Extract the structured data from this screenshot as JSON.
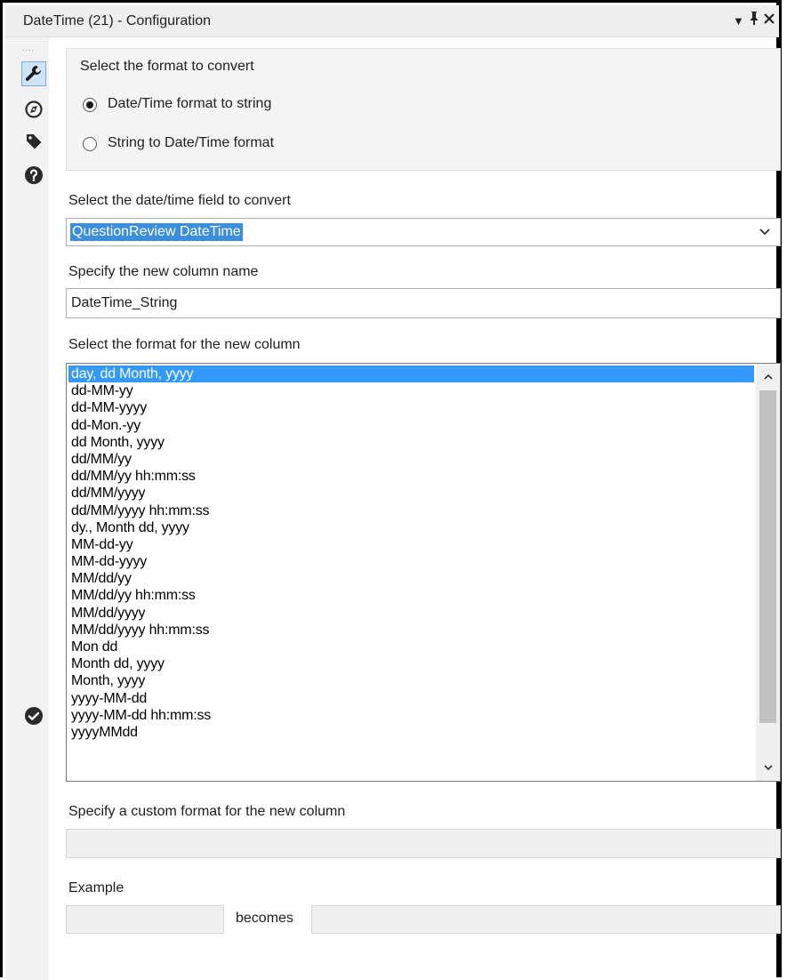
{
  "window": {
    "title": "DateTime (21) - Configuration",
    "controls": {
      "menu": "▾",
      "pin": "ᵖ",
      "close": "✕"
    }
  },
  "sidebar": {
    "grip": "....",
    "icons": [
      "wrench-icon",
      "compass-icon",
      "tag-icon",
      "help-icon"
    ],
    "footer_icon": "check-circle-icon",
    "active_color": "#cfe3f7"
  },
  "conversion": {
    "group_label": "Select the format to convert",
    "options": [
      {
        "label": "Date/Time format to string",
        "checked": true
      },
      {
        "label": "String to Date/Time format",
        "checked": false
      }
    ]
  },
  "field": {
    "label": "Select the date/time field to convert",
    "selected": "QuestionReview DateTime",
    "highlight_color": "#3b8edc"
  },
  "new_column": {
    "label": "Specify the new column name",
    "value": "DateTime_String"
  },
  "format_list": {
    "label": "Select the format for the new column",
    "selected_index": 0,
    "selection_color": "#3399ff",
    "items": [
      "day, dd Month, yyyy",
      "dd-MM-yy",
      "dd-MM-yyyy",
      "dd-Mon.-yy",
      "dd Month, yyyy",
      "dd/MM/yy",
      "dd/MM/yy hh:mm:ss",
      "dd/MM/yyyy",
      "dd/MM/yyyy hh:mm:ss",
      "dy., Month dd, yyyy",
      "MM-dd-yy",
      "MM-dd-yyyy",
      "MM/dd/yy",
      "MM/dd/yy hh:mm:ss",
      "MM/dd/yyyy",
      "MM/dd/yyyy hh:mm:ss",
      "Mon dd",
      "Month dd, yyyy",
      "Month, yyyy",
      "yyyy-MM-dd",
      "yyyy-MM-dd hh:mm:ss",
      "yyyyMMdd"
    ]
  },
  "custom_format": {
    "label": "Specify a custom format for the new column",
    "value": ""
  },
  "example": {
    "label": "Example",
    "input": "",
    "becomes_label": "becomes",
    "output": ""
  }
}
